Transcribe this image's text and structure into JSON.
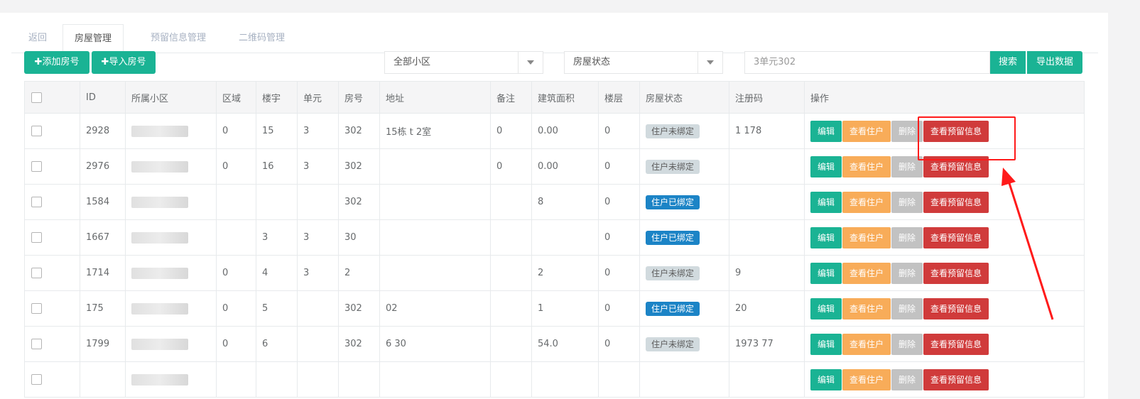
{
  "tabs": {
    "back": "返回",
    "house": "房屋管理",
    "reserve": "预留信息管理",
    "qrcode": "二维码管理"
  },
  "toolbar": {
    "add_label": "添加房号",
    "import_label": "导入房号",
    "community_select": "全部小区",
    "status_select": "房屋状态",
    "search_value": "3单元302",
    "search_label": "搜索",
    "export_label": "导出数据"
  },
  "table": {
    "headers": [
      "ID",
      "所属小区",
      "区域",
      "楼宇",
      "单元",
      "房号",
      "地址",
      "备注",
      "建筑面积",
      "楼层",
      "房屋状态",
      "注册码",
      "操作"
    ],
    "rows": [
      {
        "id": "2928",
        "area": "0",
        "building": "15",
        "unit": "3",
        "room": "302",
        "address": "15栋  t  2室",
        "remark": "0",
        "size": "0.00",
        "floor": "0",
        "status": "住户未绑定",
        "code": "1 178"
      },
      {
        "id": "2976",
        "area": "0",
        "building": "16",
        "unit": "3",
        "room": "302",
        "address": "",
        "remark": "0",
        "size": "0.00",
        "floor": "0",
        "status": "住户未绑定",
        "code": ""
      },
      {
        "id": "1584",
        "area": "",
        "building": "",
        "unit": "",
        "room": "302",
        "address": "",
        "remark": "",
        "size": "8",
        "floor": "0",
        "status": "住户已绑定",
        "code": ""
      },
      {
        "id": "1667",
        "area": "",
        "building": "3",
        "unit": "3",
        "room": "30",
        "address": "",
        "remark": "",
        "size": "",
        "floor": "0",
        "status": "住户已绑定",
        "code": ""
      },
      {
        "id": "1714",
        "area": "0",
        "building": "4",
        "unit": "3",
        "room": "2",
        "address": "",
        "remark": "",
        "size": "2",
        "floor": "0",
        "status": "住户未绑定",
        "code": "9"
      },
      {
        "id": "175",
        "area": "0",
        "building": "5",
        "unit": "",
        "room": "302",
        "address": "02",
        "remark": "",
        "size": "1",
        "floor": "0",
        "status": "住户已绑定",
        "code": "20"
      },
      {
        "id": "1799",
        "area": "0",
        "building": "6",
        "unit": "",
        "room": "302",
        "address": "6 30",
        "remark": "",
        "size": "54.0",
        "floor": "0",
        "status": "住户未绑定",
        "code": "1973 77"
      },
      {
        "id": "",
        "area": "",
        "building": "",
        "unit": "",
        "room": "",
        "address": "",
        "remark": "",
        "size": "",
        "floor": "",
        "status": "",
        "code": ""
      }
    ],
    "actions": {
      "edit": "编辑",
      "view_resident": "查看住户",
      "delete": "删除",
      "view_reserve": "查看预留信息"
    }
  },
  "colors": {
    "primary": "#1ab394",
    "warning": "#f8ac59",
    "danger": "#d03b3b",
    "info": "#1c84c6",
    "annotation": "#ff1a1a"
  }
}
